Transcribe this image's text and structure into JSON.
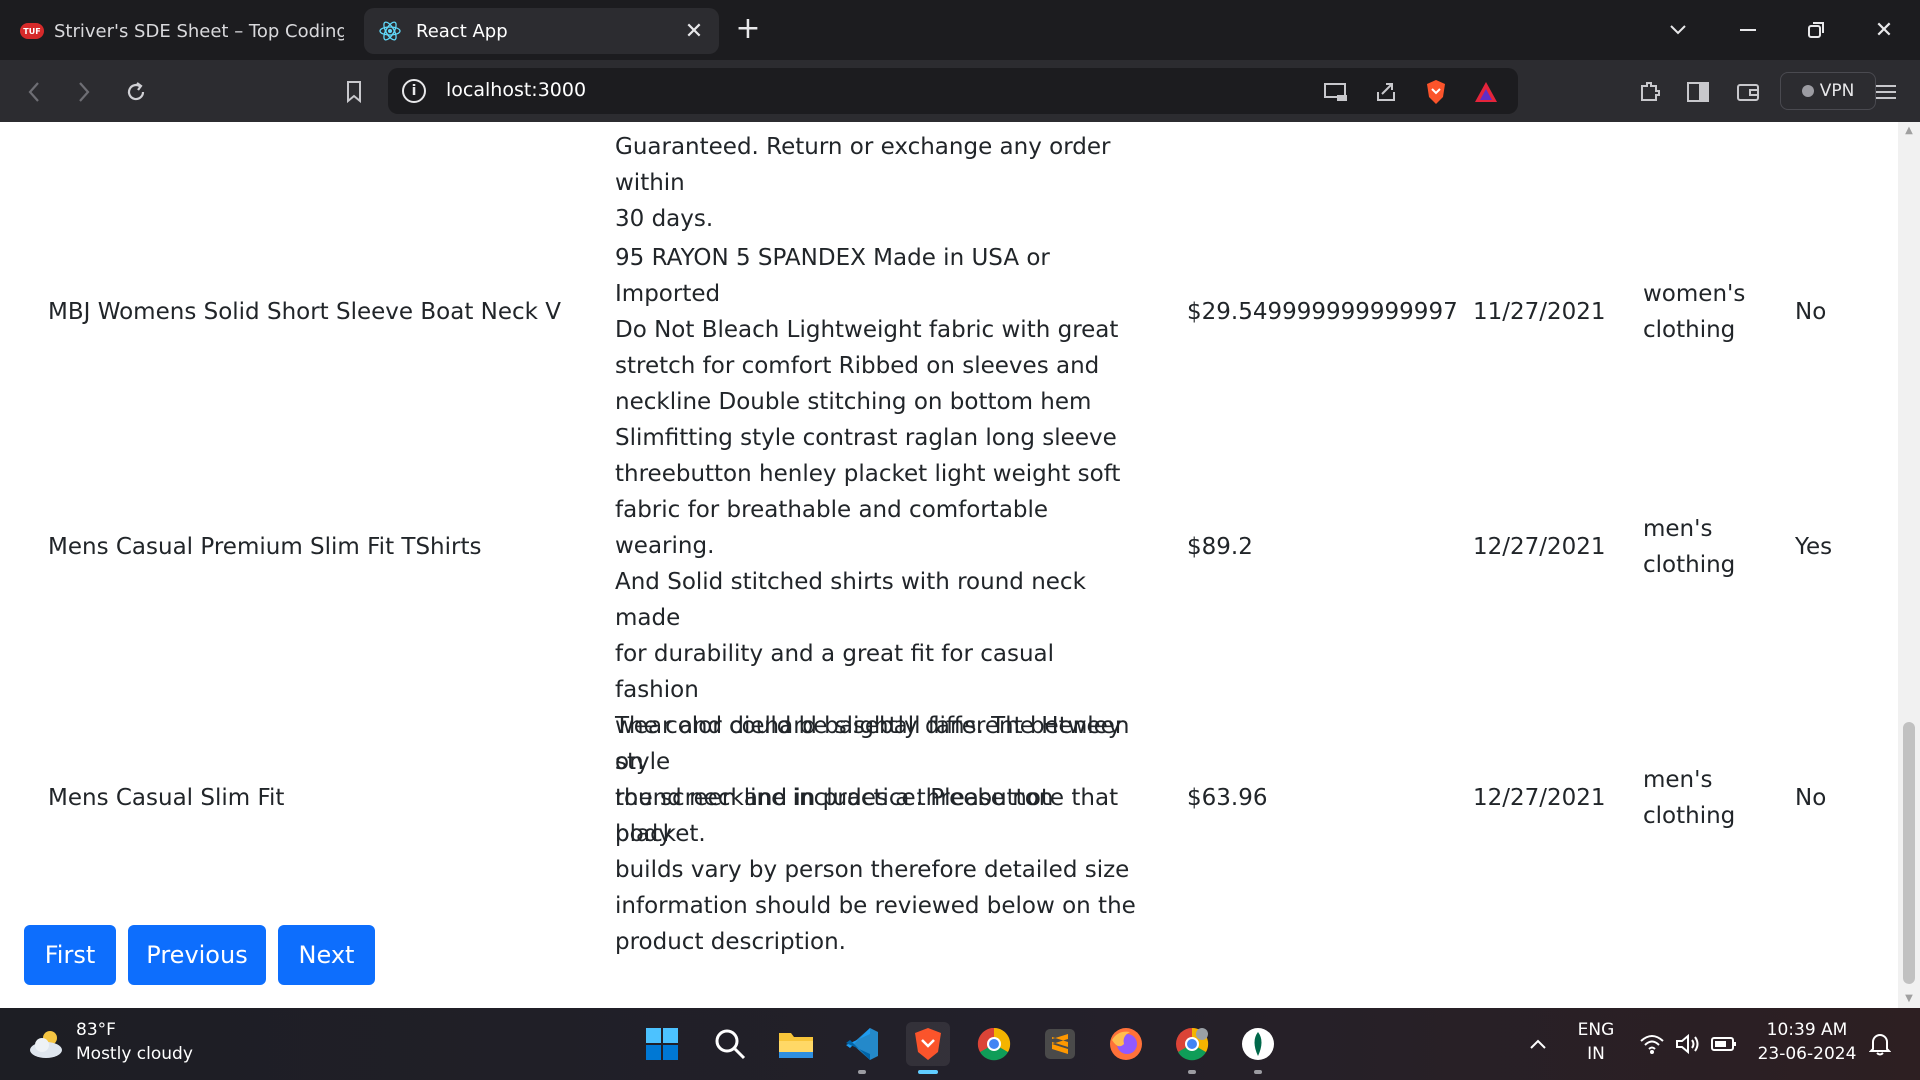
{
  "browser": {
    "tabs": [
      {
        "title": "Striver's SDE Sheet – Top Coding Interview Problems",
        "favicon": "TUF",
        "active": false
      },
      {
        "title": "React App",
        "favicon": "react-icon",
        "active": true
      }
    ],
    "url": "localhost:3000",
    "vpn_label": "VPN"
  },
  "table": {
    "partial_top_row": {
      "description_lines": [
        "Guaranteed. Return or exchange any order within",
        "30 days."
      ]
    },
    "rows": [
      {
        "title": "MBJ Womens Solid Short Sleeve Boat Neck V",
        "description_lines": [
          "95 RAYON 5 SPANDEX Made in USA or Imported",
          "Do Not Bleach Lightweight fabric with great",
          "stretch for comfort Ribbed on sleeves and",
          "neckline Double stitching on bottom hem"
        ],
        "price": "$29.549999999999997",
        "date": "11/27/2021",
        "category_lines": [
          "women's",
          "clothing"
        ],
        "rating": "No"
      },
      {
        "title": "Mens Casual Premium Slim Fit TShirts",
        "description_lines": [
          "Slimfitting style contrast raglan long sleeve",
          "threebutton henley placket light weight soft",
          "fabric for breathable and comfortable wearing.",
          "And Solid stitched shirts with round neck made",
          "for durability and a great fit for casual fashion",
          "wear and diehard baseball fans. The Henley style",
          "round neckline includes a threebutton placket."
        ],
        "price": "$89.2",
        "date": "12/27/2021",
        "category_lines": [
          "men's",
          "clothing"
        ],
        "rating": "Yes"
      },
      {
        "title": "Mens Casual Slim Fit",
        "description_lines": [
          "The color could be slightly different between on",
          "the screen and in practice. Please note that body",
          "builds vary by person therefore detailed size",
          "information should be reviewed below on the",
          "product description."
        ],
        "price": "$63.96",
        "date": "12/27/2021",
        "category_lines": [
          "men's",
          "clothing"
        ],
        "rating": "No"
      }
    ]
  },
  "pagination": {
    "first": "First",
    "previous": "Previous",
    "next": "Next",
    "color": "#0d6efd"
  },
  "taskbar": {
    "weather_temp": "83°F",
    "weather_desc": "Mostly cloudy",
    "language_line1": "ENG",
    "language_line2": "IN",
    "time": "10:39 AM",
    "date": "23-06-2024"
  }
}
